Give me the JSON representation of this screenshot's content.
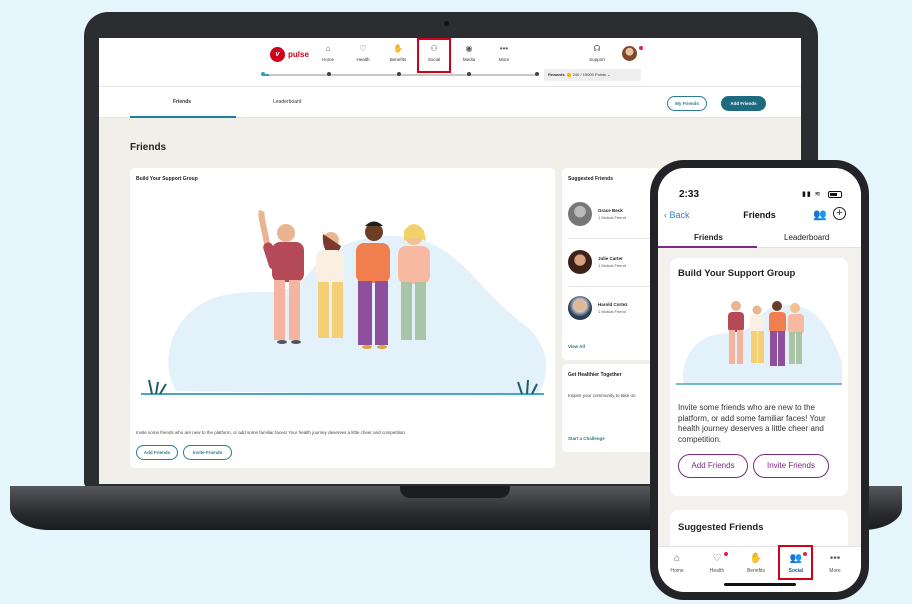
{
  "laptop": {
    "logo_text": "pulse",
    "nav": [
      {
        "label": "Home",
        "icon": "home-icon"
      },
      {
        "label": "Health",
        "icon": "heart-icon"
      },
      {
        "label": "Benefits",
        "icon": "benefits-icon"
      },
      {
        "label": "Social",
        "icon": "social-icon"
      },
      {
        "label": "Media",
        "icon": "media-icon"
      },
      {
        "label": "More",
        "icon": "more-icon"
      }
    ],
    "support_label": "Support",
    "rewards_label": "Rewards",
    "rewards_points": "240 / 19000 Points",
    "tabs": [
      "Friends",
      "Leaderboard"
    ],
    "my_friends_button": "My Friends",
    "add_friends_button": "Add Friends",
    "page_title": "Friends",
    "support_card": {
      "title": "Build Your Support Group",
      "text": "Invite some friends who are new to the platform, or add some familiar faces! Your health journey deserves a little cheer and competition.",
      "add_button": "Add Friends",
      "invite_button": "Invite Friends"
    },
    "suggested": {
      "title": "Suggested Friends",
      "people": [
        {
          "name": "Grace Beck",
          "mutual": "1 Mutual Friend"
        },
        {
          "name": "Julie Carter",
          "mutual": "1 Mutual Friend"
        },
        {
          "name": "Harold Cortez",
          "mutual": "1 Mutual Friend"
        }
      ],
      "view_all": "View All"
    },
    "healthier": {
      "title": "Get Healthier Together",
      "text": "Inspire your community to take on",
      "link": "Start a Challenge"
    }
  },
  "phone": {
    "time": "2:33",
    "back_label": "Back",
    "title": "Friends",
    "tabs": [
      "Friends",
      "Leaderboard"
    ],
    "card_title": "Build Your Support Group",
    "card_text": "Invite some friends who are new to the platform, or add some familiar faces! Your health journey deserves a little cheer and competition.",
    "add_button": "Add Friends",
    "invite_button": "Invite Friends",
    "suggested_title": "Suggested Friends",
    "bottom_nav": [
      {
        "label": "Home",
        "icon": "home-icon"
      },
      {
        "label": "Health",
        "icon": "heart-icon"
      },
      {
        "label": "Benefits",
        "icon": "benefits-icon"
      },
      {
        "label": "Social",
        "icon": "social-icon"
      },
      {
        "label": "More",
        "icon": "more-icon"
      }
    ]
  },
  "colors": {
    "brand_red": "#d0021b",
    "accent_teal": "#1e6b80",
    "phone_accent": "#7b2b82",
    "background": "#e4f6fb"
  }
}
